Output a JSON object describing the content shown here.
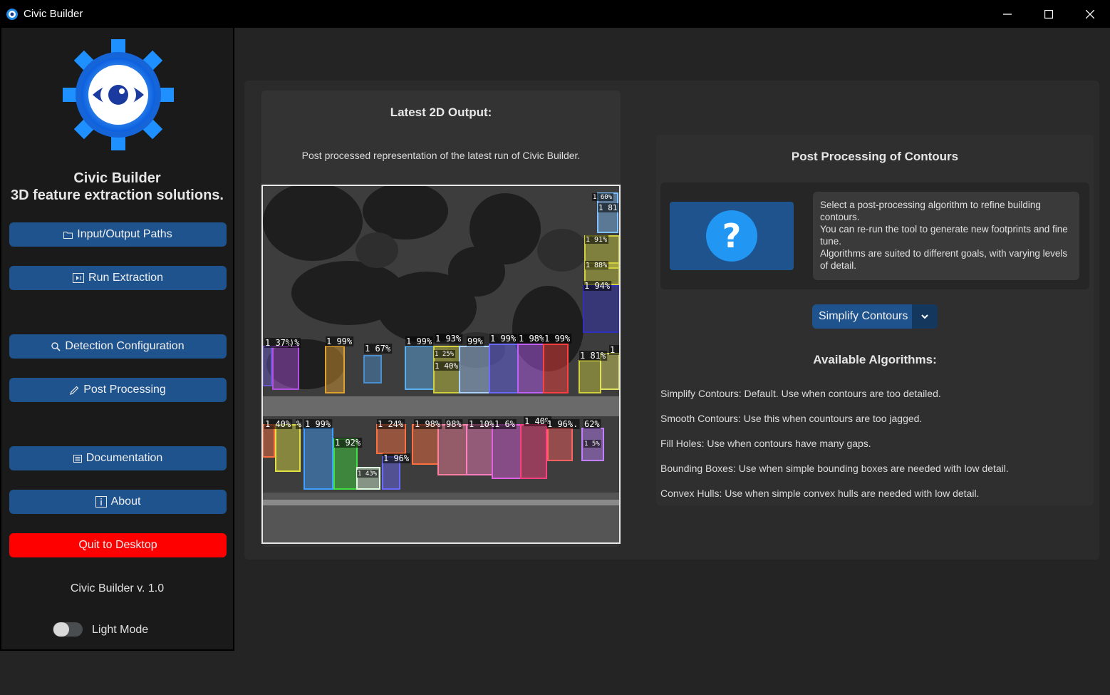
{
  "window": {
    "title": "Civic Builder",
    "accent": "#1f538d",
    "quit_color": "#ff0000"
  },
  "sidebar": {
    "brand_line1": "Civic Builder",
    "brand_line2": "3D feature extraction solutions.",
    "buttons": [
      {
        "label": "Input/Output Paths",
        "icon": "folder-icon"
      },
      {
        "label": "Run Extraction",
        "icon": "run-icon"
      },
      {
        "label": "Detection Configuration",
        "icon": "search-icon"
      },
      {
        "label": "Post Processing",
        "icon": "pencil-icon"
      },
      {
        "label": "Documentation",
        "icon": "document-icon"
      },
      {
        "label": "About",
        "icon": "info-icon"
      }
    ],
    "quit_label": "Quit to Desktop",
    "version": "Civic Builder v. 1.0",
    "toggle_label": "Light Mode",
    "toggle_on": false
  },
  "output": {
    "title": "Latest 2D Output:",
    "subtitle": "Post processed representation of the latest run of Civic Builder.",
    "detections": [
      "1 60%",
      "1 81",
      "1 91%",
      "1 88%",
      "1 94%",
      "1 37%",
      ")%",
      "1 99%",
      "1 67%",
      "1 99%",
      "1 93%",
      "99%",
      "1 99%",
      "1 98%",
      "1 99%",
      "1 81%",
      "1 94",
      "1 25%",
      "1 40%",
      "1 40%",
      "%",
      "1 99%",
      "1 24%",
      "1 98%",
      "98%",
      "1 10%",
      "1 6%",
      "1 40%",
      "1 96%.",
      "62%",
      "1 92%",
      "1 96%",
      "1 43%",
      "1 5%"
    ]
  },
  "post_processing": {
    "title": "Post Processing of Contours",
    "info_icon": "question-icon",
    "info_lines": [
      "Select a post-processing algorithm to refine building contours.",
      "You can re-run the tool to generate new footprints and fine tune.",
      "Algorithms are suited to different goals, with varying levels of detail."
    ],
    "selected_algorithm": "Simplify Contours",
    "algorithms_title": "Available Algorithms:",
    "algorithms": [
      "Simplify Contours: Default. Use when contours are too detailed.",
      "Smooth Contours: Use this when countours are too jagged.",
      "Fill Holes: Use when contours have many gaps.",
      "Bounding Boxes: Use when simple bounding boxes are needed with low detail.",
      "Convex Hulls: Use when simple convex hulls are needed with low detail."
    ]
  }
}
